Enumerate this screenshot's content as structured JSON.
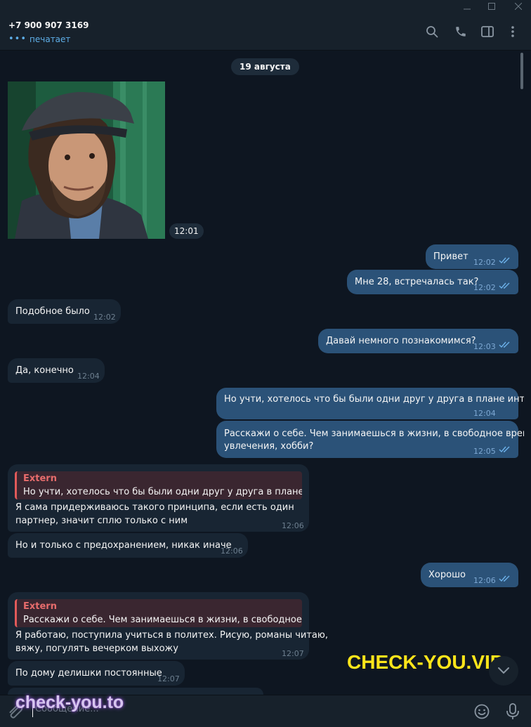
{
  "window": {
    "minimize": "—",
    "maximize": "□"
  },
  "header": {
    "contact_name": "+7 900 907 3169",
    "status": "печатает",
    "icons": [
      "search-icon",
      "phone-icon",
      "sidebar-toggle-icon",
      "more-vert-icon"
    ]
  },
  "chat": {
    "date_label": "19 августа",
    "photo_time": "12:01",
    "messages": [
      {
        "dir": "out",
        "text": "Привет",
        "time": "12:02"
      },
      {
        "dir": "out",
        "text": "Мне 28, встречалась так?",
        "time": "12:02"
      },
      {
        "dir": "in",
        "text": "Подобное было",
        "time": "12:02"
      },
      {
        "dir": "out",
        "text": "Давай немного познакомимся?",
        "time": "12:03"
      },
      {
        "dir": "in",
        "text": "Да, конечно",
        "time": "12:04"
      },
      {
        "dir": "out",
        "text": "Но учти, хотелось что бы были одни друг у друга в плане интима",
        "time": "12:04"
      },
      {
        "dir": "out",
        "text_line1": "Расскажи о себе. Чем занимаешься в жизни, в свободное время,",
        "text_line2": "увлечения, хобби?",
        "time": "12:05"
      },
      {
        "dir": "in",
        "reply_name": "Extern",
        "reply_text": "Но учти, хотелось что бы были одни друг у друга в плане ин...",
        "text_line1": "Я сама придерживаюсь такого принципа, если есть один",
        "text_line2": "партнер, значит сплю только с ним",
        "time": "12:06"
      },
      {
        "dir": "in",
        "text": "Но и только с предохранением, никак иначе",
        "time": "12:06"
      },
      {
        "dir": "out",
        "text": "Хорошо",
        "time": "12:06"
      },
      {
        "dir": "in",
        "reply_name": "Extern",
        "reply_text": "Расскажи о себе. Чем занимаешься в жизни, в свободное вр...",
        "text_line1": "Я работаю, поступила учиться в политех. Рисую, романы читаю,",
        "text_line2": "вяжу, погулять вечерком выхожу",
        "time": "12:07"
      },
      {
        "dir": "in",
        "text": "По дому делишки постоянные",
        "time": "12:07"
      }
    ]
  },
  "composer": {
    "placeholder": "Сообщение..."
  },
  "watermarks": {
    "big": "CHECK-YOU.VIP",
    "small": "check-you.to"
  },
  "colors": {
    "background": "#0e1621",
    "incoming": "#182533",
    "outgoing": "#2b5278",
    "accent": "#5eaee7",
    "reply_bar": "#e15a5a",
    "watermark_big": "#ffe51a"
  }
}
